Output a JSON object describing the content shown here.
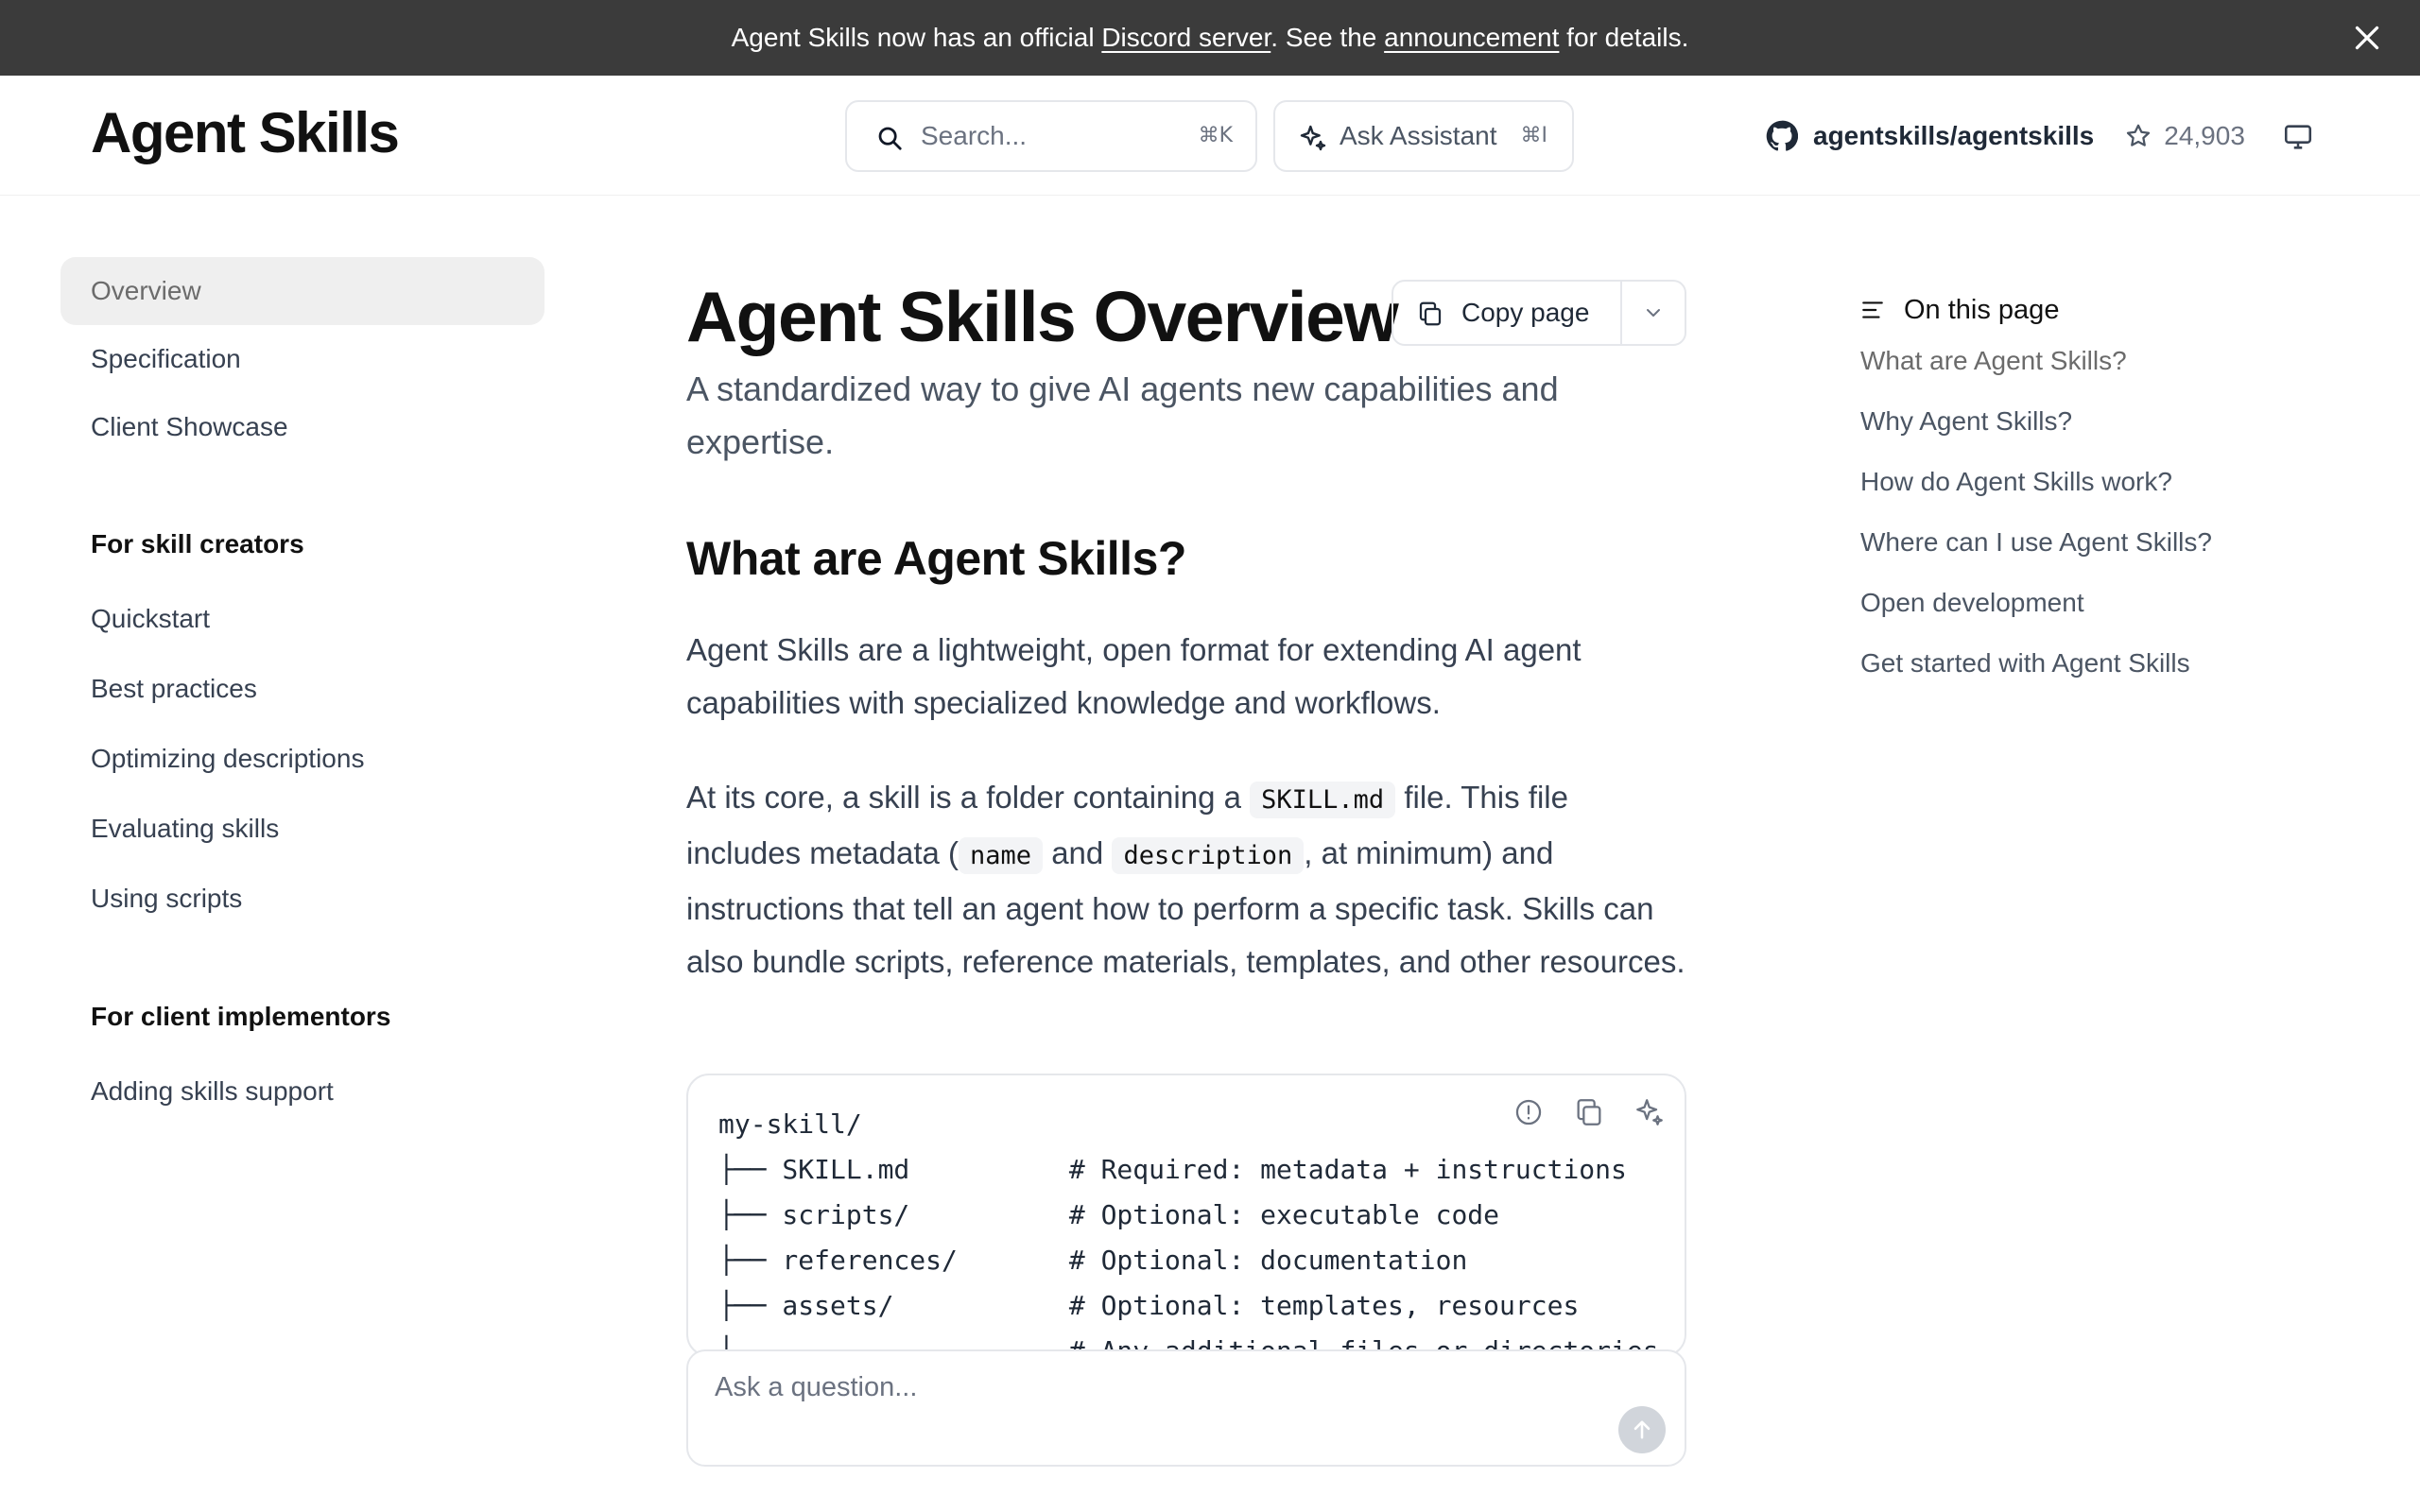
{
  "banner": {
    "text_before": "Agent Skills now has an official ",
    "discord_link": "Discord server",
    "text_middle": ". See the ",
    "announcement_link": "announcement",
    "text_after": " for details."
  },
  "header": {
    "logo": "Agent Skills",
    "search_placeholder": "Search...",
    "search_shortcut": "⌘K",
    "ask_label": "Ask Assistant",
    "ask_shortcut": "⌘I",
    "repo": "agentskills/agentskills",
    "stars": "24,903"
  },
  "sidebar": {
    "items": [
      {
        "label": "Overview"
      },
      {
        "label": "Specification"
      },
      {
        "label": "Client Showcase"
      }
    ],
    "section_creators": "For skill creators",
    "creator_items": [
      {
        "label": "Quickstart"
      },
      {
        "label": "Best practices"
      },
      {
        "label": "Optimizing descriptions"
      },
      {
        "label": "Evaluating skills"
      },
      {
        "label": "Using scripts"
      }
    ],
    "section_implementors": "For client implementors",
    "implementor_items": [
      {
        "label": "Adding skills support"
      }
    ]
  },
  "main": {
    "title": "Agent Skills Overview",
    "copy_label": "Copy page",
    "subtitle": "A standardized way to give AI agents new capabilities and expertise.",
    "h2": "What are Agent Skills?",
    "p1": "Agent Skills are a lightweight, open format for extending AI agent capabilities with specialized knowledge and workflows.",
    "p2": {
      "t1": "At its core, a skill is a folder containing a ",
      "c1": "SKILL.md",
      "t2": " file. This file includes metadata (",
      "c2": "name",
      "t3": " and ",
      "c3": "description",
      "t4": ", at minimum) and instructions that tell an agent how to perform a specific task. Skills can also bundle scripts, reference materials, templates, and other resources."
    },
    "code": [
      "my-skill/",
      "├── SKILL.md          # Required: metadata + instructions",
      "├── scripts/          # Optional: executable code",
      "├── references/       # Optional: documentation",
      "├── assets/           # Optional: templates, resources",
      "└── ...               # Any additional files or directories"
    ]
  },
  "ask_box": {
    "placeholder": "Ask a question..."
  },
  "toc": {
    "heading": "On this page",
    "items": [
      {
        "label": "What are Agent Skills?"
      },
      {
        "label": "Why Agent Skills?"
      },
      {
        "label": "How do Agent Skills work?"
      },
      {
        "label": "Where can I use Agent Skills?"
      },
      {
        "label": "Open development"
      },
      {
        "label": "Get started with Agent Skills"
      }
    ]
  }
}
